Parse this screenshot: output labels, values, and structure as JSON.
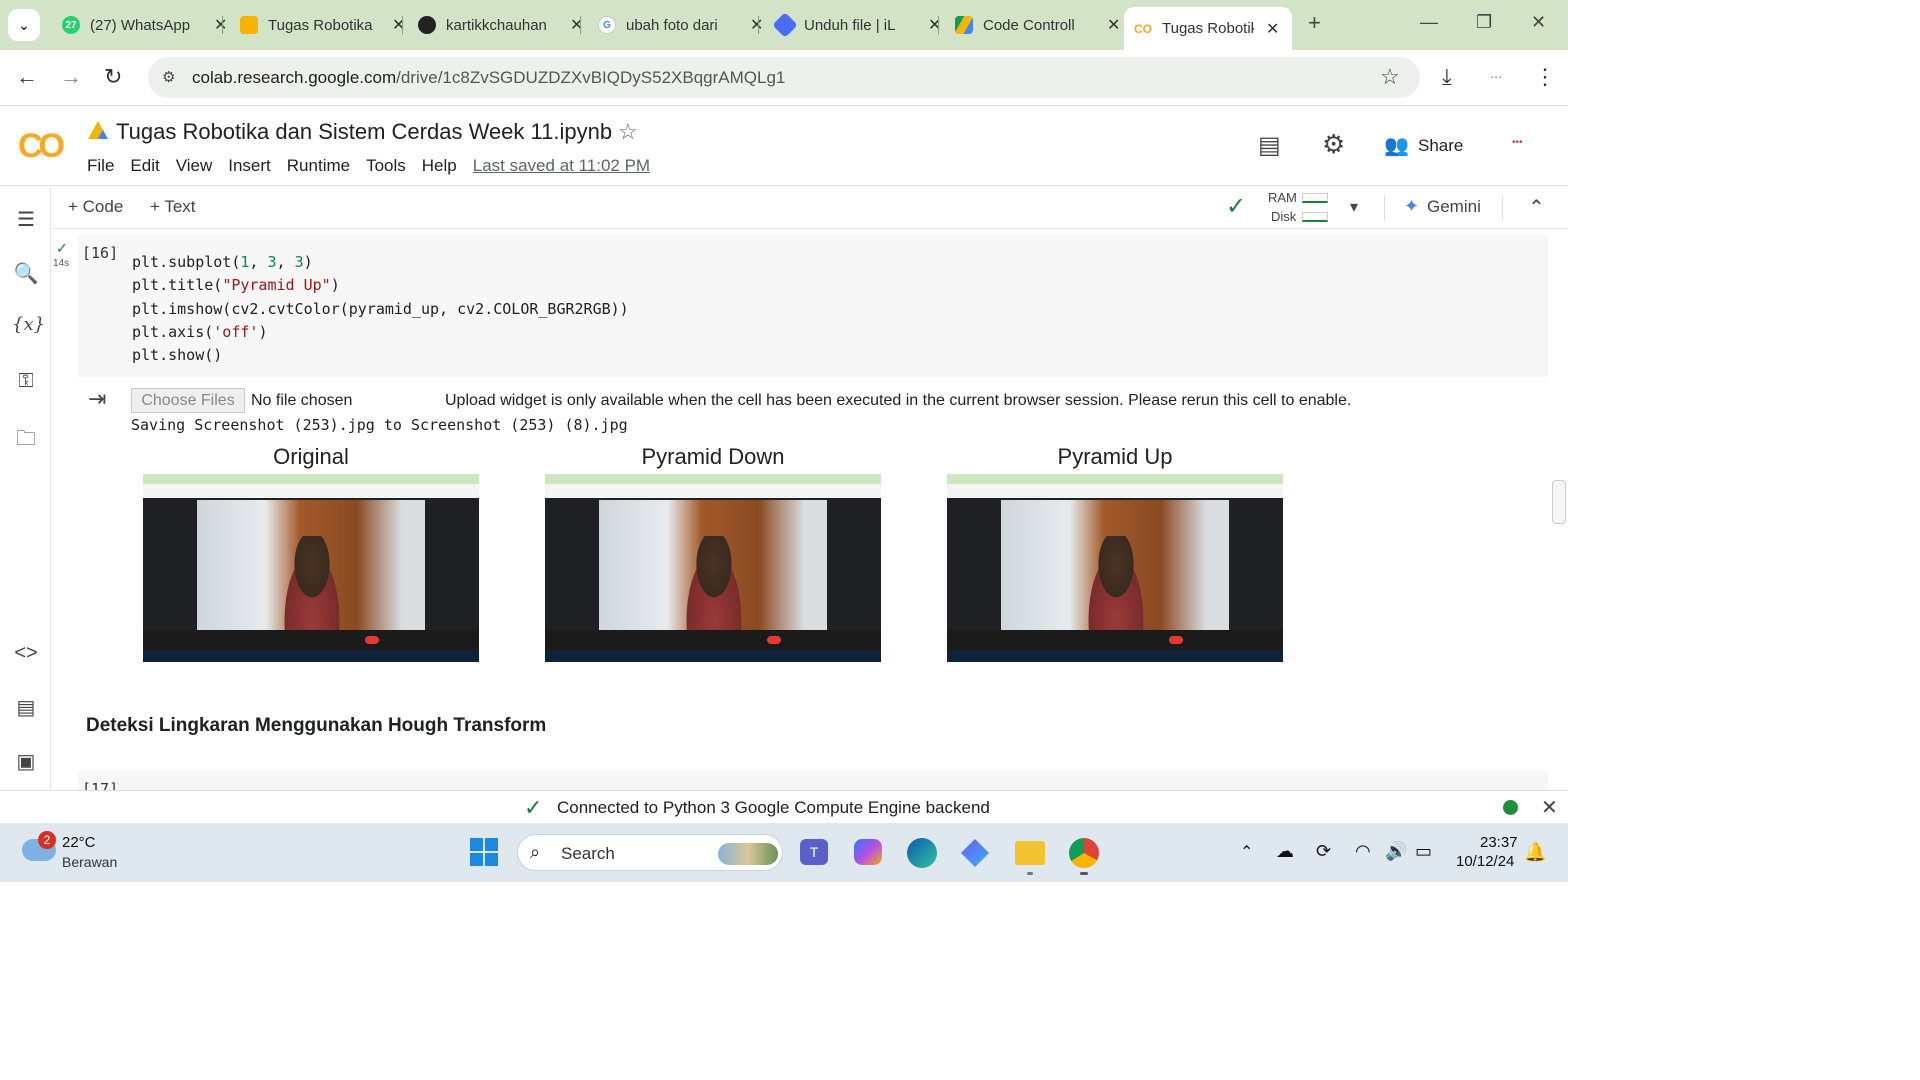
{
  "browser": {
    "tabs": [
      {
        "label": "(27) WhatsApp",
        "badge": "27",
        "icon": "whatsapp-icon"
      },
      {
        "label": "Tugas Robotika",
        "icon": "slides-icon"
      },
      {
        "label": "kartikkchauhan",
        "icon": "github-icon"
      },
      {
        "label": "ubah foto dari",
        "icon": "google-icon"
      },
      {
        "label": "Unduh file | iL",
        "icon": "ilovepdf-icon"
      },
      {
        "label": "Code Controll",
        "icon": "drive-icon"
      },
      {
        "label": "Tugas Robotik",
        "icon": "colab-icon",
        "active": true
      }
    ],
    "new_tab": "+",
    "url_host": "colab.research.google.com",
    "url_path": "/drive/1c8ZvSGDUZDZXvBIQDyS52XBqgrAMQLg1"
  },
  "colab": {
    "logo": "CO",
    "title": "Tugas Robotika dan Sistem Cerdas Week 11.ipynb",
    "menu": [
      "File",
      "Edit",
      "View",
      "Insert",
      "Runtime",
      "Tools",
      "Help"
    ],
    "last_saved": "Last saved at 11:02 PM",
    "share": "Share",
    "toolbar": {
      "code": "+ Code",
      "text": "+ Text",
      "ram": "RAM",
      "disk": "Disk",
      "gemini": "Gemini"
    }
  },
  "cell": {
    "exec_count": "[16]",
    "exec_time": "14s",
    "code_lines": [
      "plt.subplot(1, 3, 3)",
      "plt.title(\"Pyramid Up\")",
      "plt.imshow(cv2.cvtColor(pyramid_up, cv2.COLOR_BGR2RGB))",
      "plt.axis('off')",
      "plt.show()"
    ]
  },
  "output": {
    "choose_files": "Choose Files",
    "no_file": "No file chosen",
    "upload_note": "Upload widget is only available when the cell has been executed in the current browser session. Please rerun this cell to enable.",
    "saving": "Saving Screenshot (253).jpg to Screenshot (253) (8).jpg",
    "subplots": [
      "Original",
      "Pyramid Down",
      "Pyramid Up"
    ]
  },
  "next_section": {
    "heading": "Deteksi Lingkaran Menggunakan Hough Transform",
    "exec_count": "[17]"
  },
  "status": {
    "message": "Connected to Python 3 Google Compute Engine backend"
  },
  "taskbar": {
    "weather_badge": "2",
    "temperature": "22°C",
    "condition": "Berawan",
    "search": "Search",
    "time": "23:37",
    "date": "10/12/24"
  },
  "colors": {
    "tabstrip": "#d3e3c8",
    "colab_orange": "#f9a825",
    "check_green": "#188038",
    "status_dot": "#1e8e3e"
  }
}
